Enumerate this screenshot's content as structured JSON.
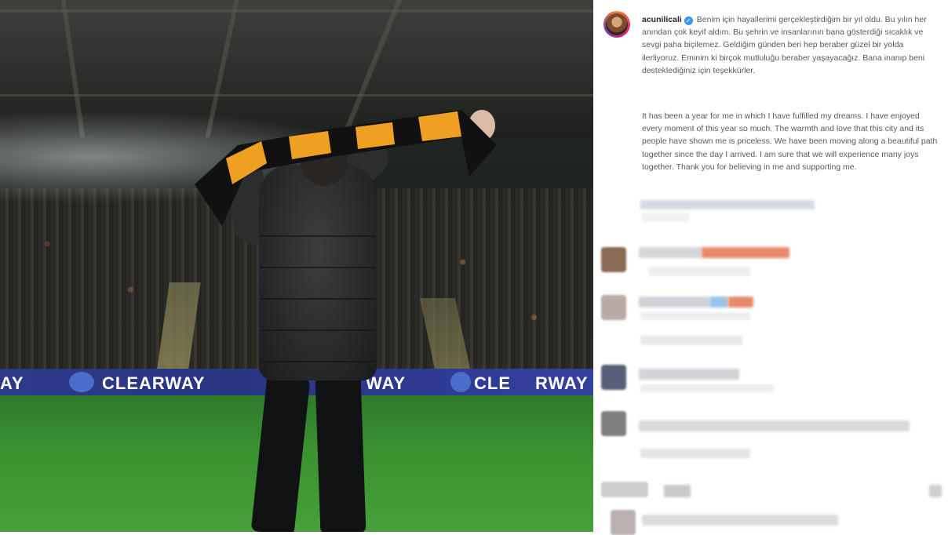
{
  "post": {
    "username": "acunilicali",
    "verified_icon": "verified-badge-icon",
    "caption_tr": "Benim için hayallerimi gerçekleştirdiğim bir yıl oldu. Bu yılın her anından çok keyif aldım. Bu şehrin ve insanlarının bana gösterdiği sıcaklık ve sevgi paha biçilemez. Geldiğim günden beri hep beraber güzel bir yolda ilerliyoruz. Eminim ki birçok mutluluğu beraber yaşayacağız. Bana inanıp beni desteklediğiniz için teşekkürler.",
    "caption_en": "It has been a year for me in which I have fulfilled my dreams. I have enjoyed every moment of this year so much. The warmth and love that this city and its people have shown me is priceless. We have been moving along a beautiful path together since the day I arrived. I am sure that we will experience many joys together. Thank you for believing in me and supporting me."
  },
  "photo": {
    "hoarding_text_left": "AY",
    "hoarding_text_main": "CLEARWAY",
    "hoarding_text_right1": "WAY",
    "hoarding_text_right2": "CLE",
    "hoarding_text_right3": "RWAY"
  },
  "colors": {
    "scarf_amber": "#f0a020",
    "scarf_black": "#111111",
    "hoarding_blue": "#2d3a8c",
    "blur_orange": "#e88a6a",
    "blur_blue": "#9cc4e8"
  }
}
